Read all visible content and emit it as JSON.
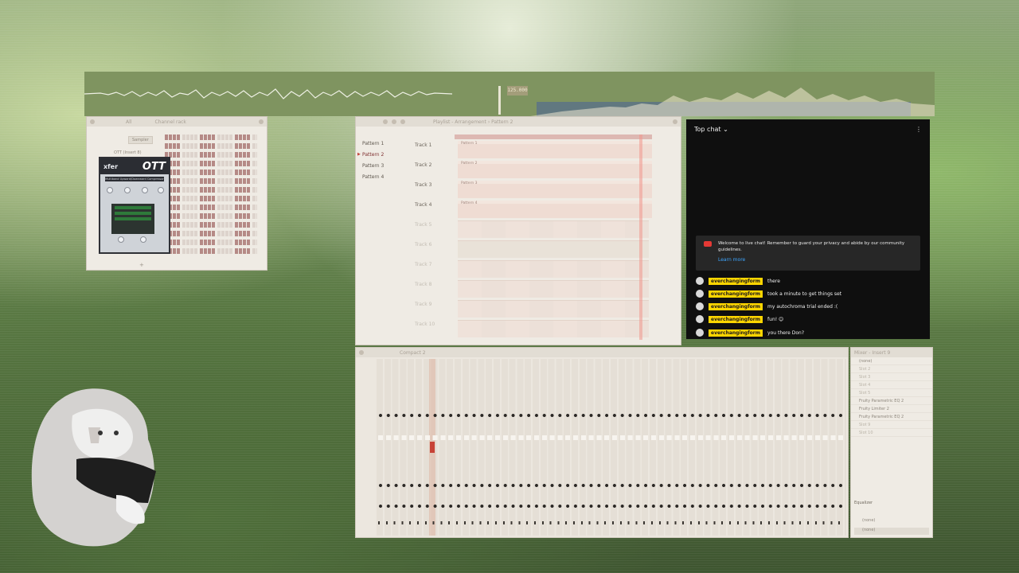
{
  "tempo_display": "125.000",
  "channel_rack": {
    "title": "Channel rack",
    "filter_label": "All",
    "sampler_label": "Sampler",
    "plugin_window_title": "OTT (Insert 8)"
  },
  "ott": {
    "brand": "xfer",
    "title": "OTT",
    "preset_bar": "Multiband Upward/Downward Compressor"
  },
  "playlist": {
    "title": "Playlist - Arrangement › Pattern 2",
    "patterns": [
      "Pattern 1",
      "Pattern 2",
      "Pattern 3",
      "Pattern 4"
    ],
    "selected_pattern_index": 1,
    "tracks": [
      "Track 1",
      "Track 2",
      "Track 3",
      "Track 4",
      "Track 5",
      "Track 6",
      "Track 7",
      "Track 8",
      "Track 9",
      "Track 10"
    ],
    "clips": [
      "Pattern 1",
      "Pattern 2",
      "Pattern 3",
      "Pattern 4"
    ]
  },
  "chat": {
    "header": "Top chat",
    "notice": "Welcome to live chat! Remember to guard your privacy and abide by our community guidelines.",
    "learn_more": "Learn more",
    "messages": [
      {
        "author": "everchangingform",
        "text": "there"
      },
      {
        "author": "everchangingform",
        "text": "took a minute to get things set"
      },
      {
        "author": "everchangingform",
        "text": "my autochroma trial ended :("
      },
      {
        "author": "everchangingform",
        "text": "fun! 😊"
      },
      {
        "author": "everchangingform",
        "text": "you there Don?"
      }
    ]
  },
  "mixer": {
    "title": "Compact 2",
    "insert_title": "Mixer - Insert 9",
    "slots": [
      "(none)",
      "Slot 2",
      "Slot 3",
      "Slot 4",
      "Slot 5",
      "Fruity Parametric EQ 2",
      "Fruity Limiter 2",
      "Fruity Parametric EQ 2",
      "Slot 9",
      "Slot 10"
    ],
    "eq_label": "Equalizer",
    "out_label_1": "(none)",
    "out_label_2": "(none)"
  },
  "colors": {
    "chat_name_badge": "#ffd600",
    "accent_red": "#c74236",
    "link_blue": "#3ea6ff"
  }
}
